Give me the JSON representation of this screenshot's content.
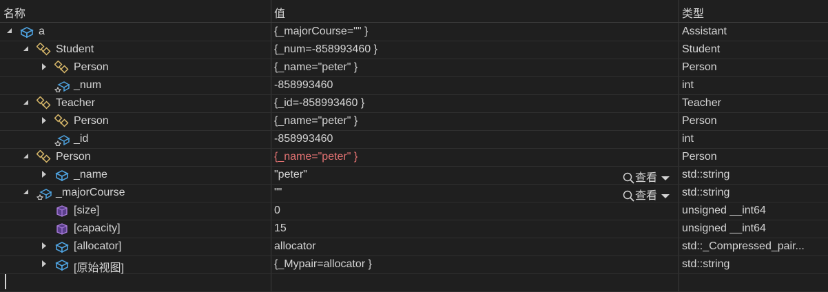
{
  "header": {
    "name": "名称",
    "value": "值",
    "type": "类型"
  },
  "rows": [
    {
      "name": "a",
      "value": "{_majorCourse=\"\" }",
      "type": "Assistant"
    },
    {
      "name": "Student",
      "value": "{_num=-858993460 }",
      "type": "Student"
    },
    {
      "name": "Person",
      "value": "{_name=\"peter\" }",
      "type": "Person"
    },
    {
      "name": "_num",
      "value": "-858993460",
      "type": "int"
    },
    {
      "name": "Teacher",
      "value": "{_id=-858993460 }",
      "type": "Teacher"
    },
    {
      "name": "Person",
      "value": "{_name=\"peter\" }",
      "type": "Person"
    },
    {
      "name": "_id",
      "value": "-858993460",
      "type": "int"
    },
    {
      "name": "Person",
      "value": "{_name=\"peter\" }",
      "type": "Person"
    },
    {
      "name": "_name",
      "value": "\"peter\"",
      "type": "std::string"
    },
    {
      "name": "_majorCourse",
      "value": "\"\"",
      "type": "std::string"
    },
    {
      "name": "[size]",
      "value": "0",
      "type": "unsigned __int64"
    },
    {
      "name": "[capacity]",
      "value": "15",
      "type": "unsigned __int64"
    },
    {
      "name": "[allocator]",
      "value": "allocator",
      "type": "std::_Compressed_pair..."
    },
    {
      "name": "[原始视图]",
      "value": "{_Mypair=allocator }",
      "type": "std::string"
    }
  ],
  "view_button": {
    "label": "查看"
  },
  "colors": {
    "background": "#1f1f1f",
    "text": "#d4d4d4",
    "changed_value": "#e57373",
    "icon_blue": "#4fa3e0",
    "icon_gold": "#d8b86a",
    "icon_purple": "#a77ad8"
  }
}
